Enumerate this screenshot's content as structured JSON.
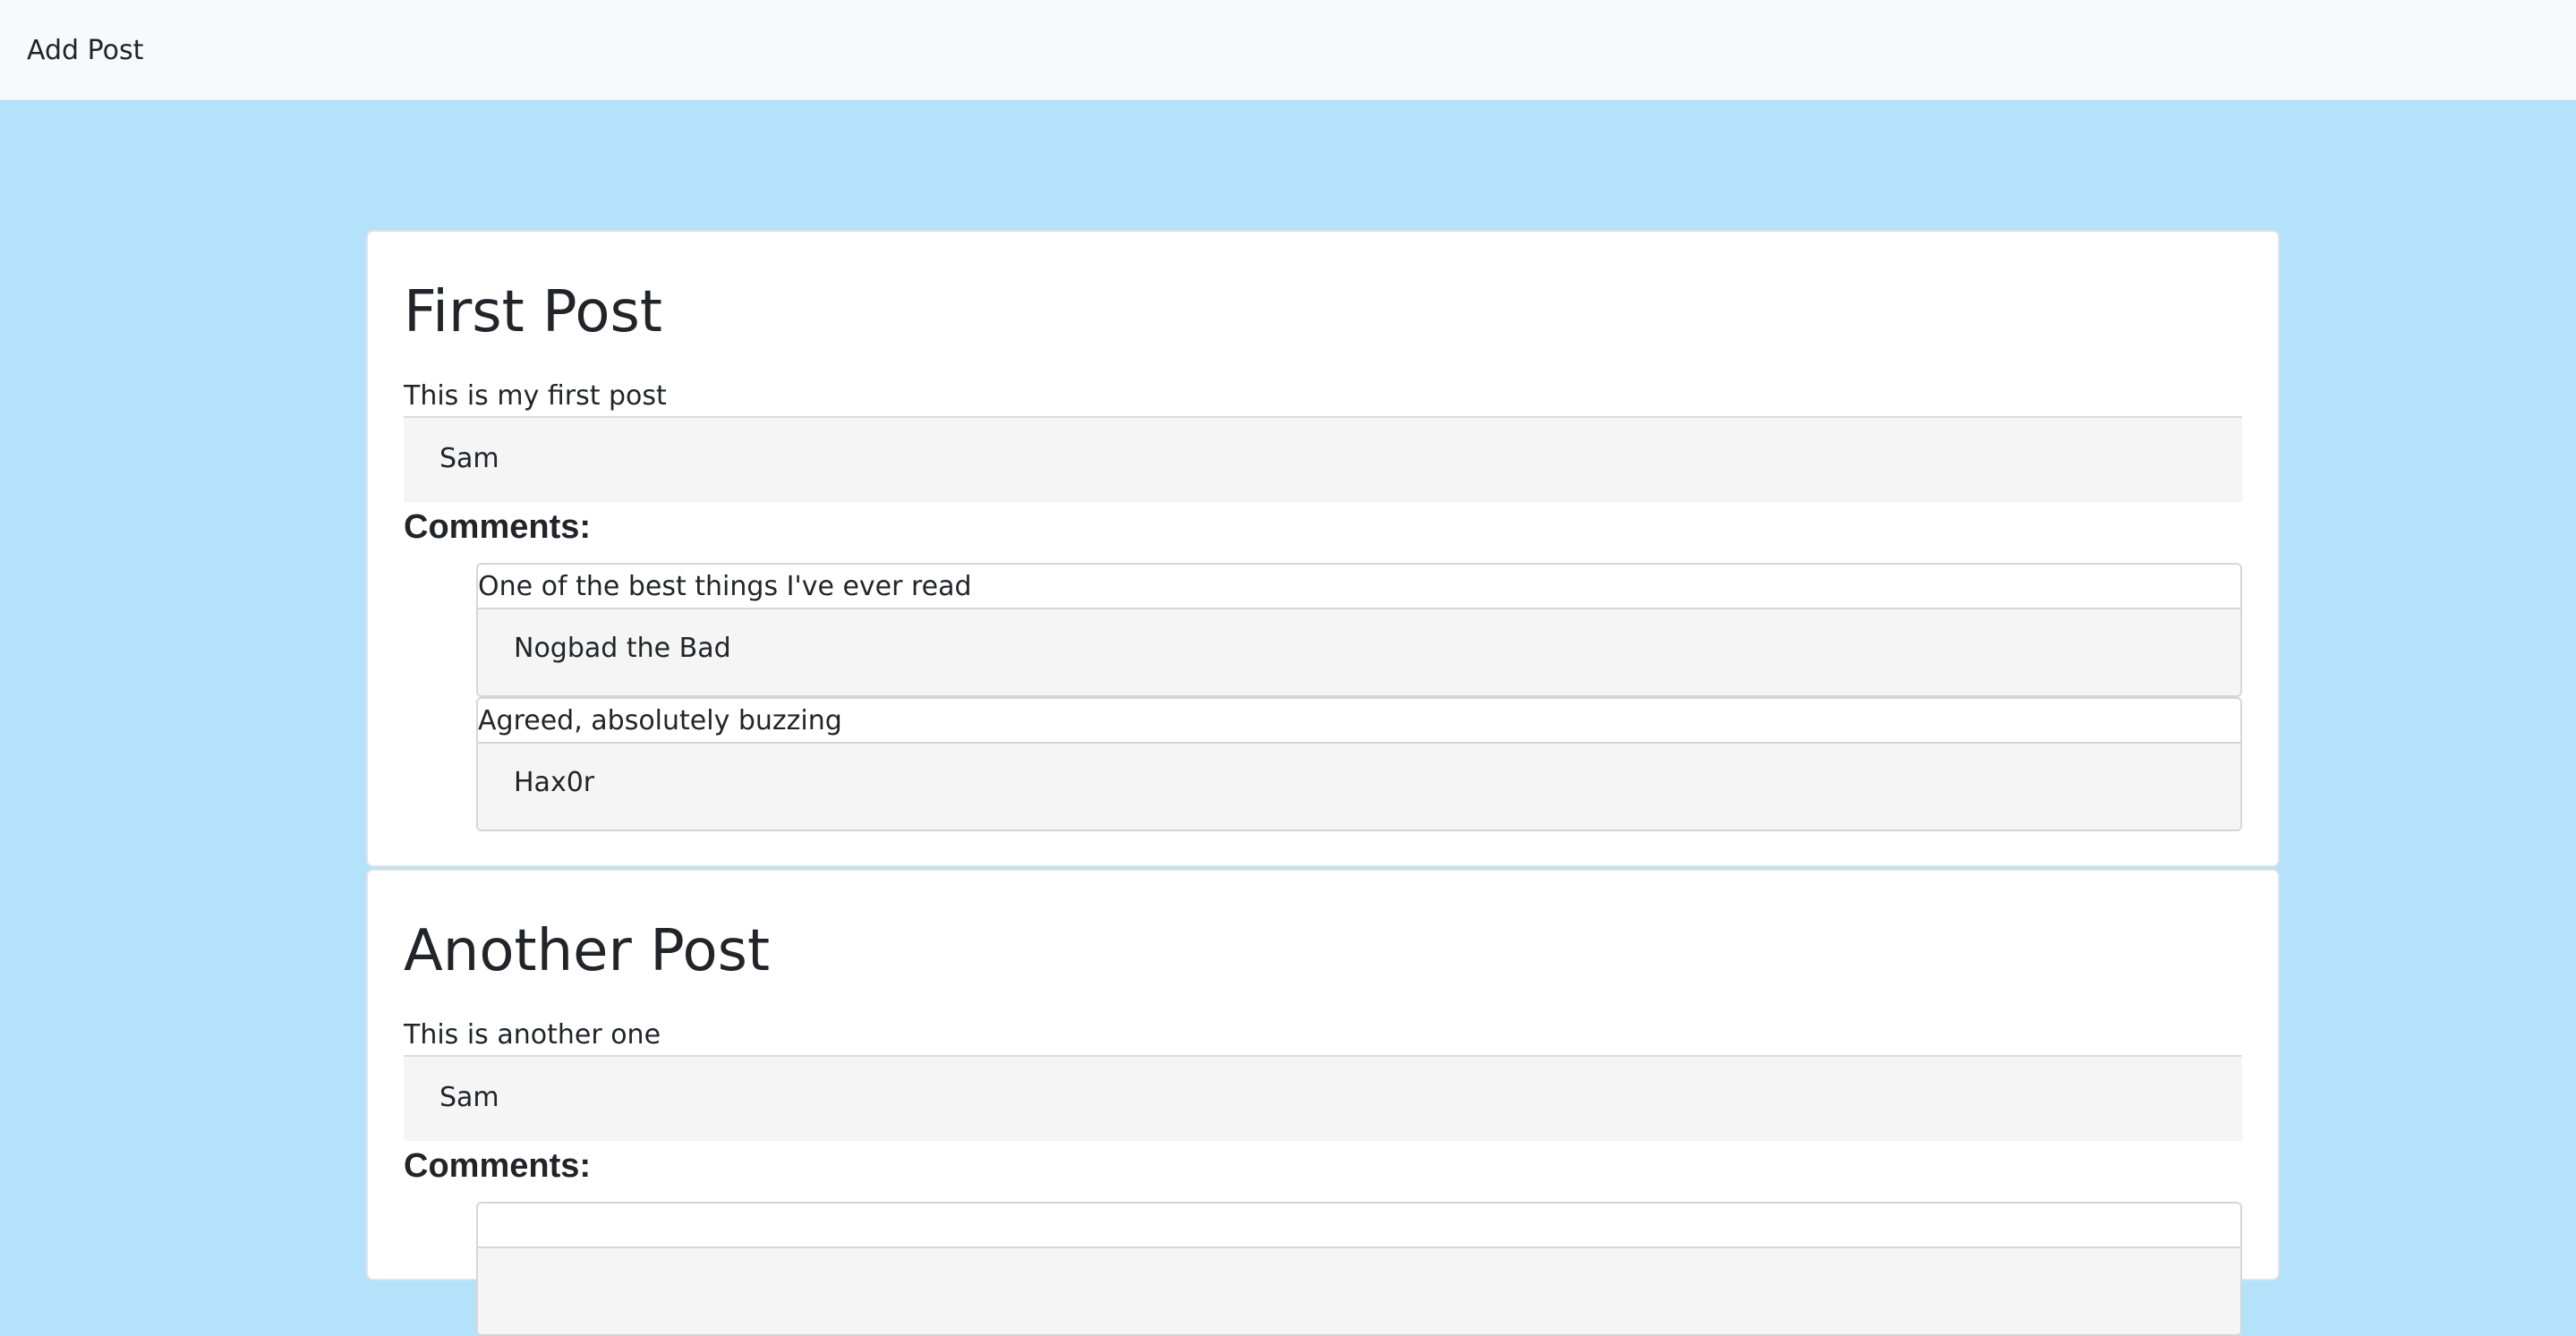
{
  "navbar": {
    "add_post_label": "Add Post"
  },
  "posts": [
    {
      "title": "First Post",
      "body": "This is my first post",
      "author": "Sam",
      "comments_heading": "Comments:",
      "comments": [
        {
          "text": "One of the best things I've ever read",
          "author": "Nogbad the Bad"
        },
        {
          "text": "Agreed, absolutely buzzing",
          "author": "Hax0r"
        }
      ]
    },
    {
      "title": "Another Post",
      "body": "This is another one",
      "author": "Sam",
      "comments_heading": "Comments:",
      "comments": [
        {
          "text": "",
          "author": ""
        }
      ]
    }
  ],
  "colors": {
    "page_background": "#b3e2fa",
    "navbar_background": "#f8f9fa",
    "card_background": "#ffffff",
    "author_background": "#f5f5f5",
    "text": "#212529"
  }
}
